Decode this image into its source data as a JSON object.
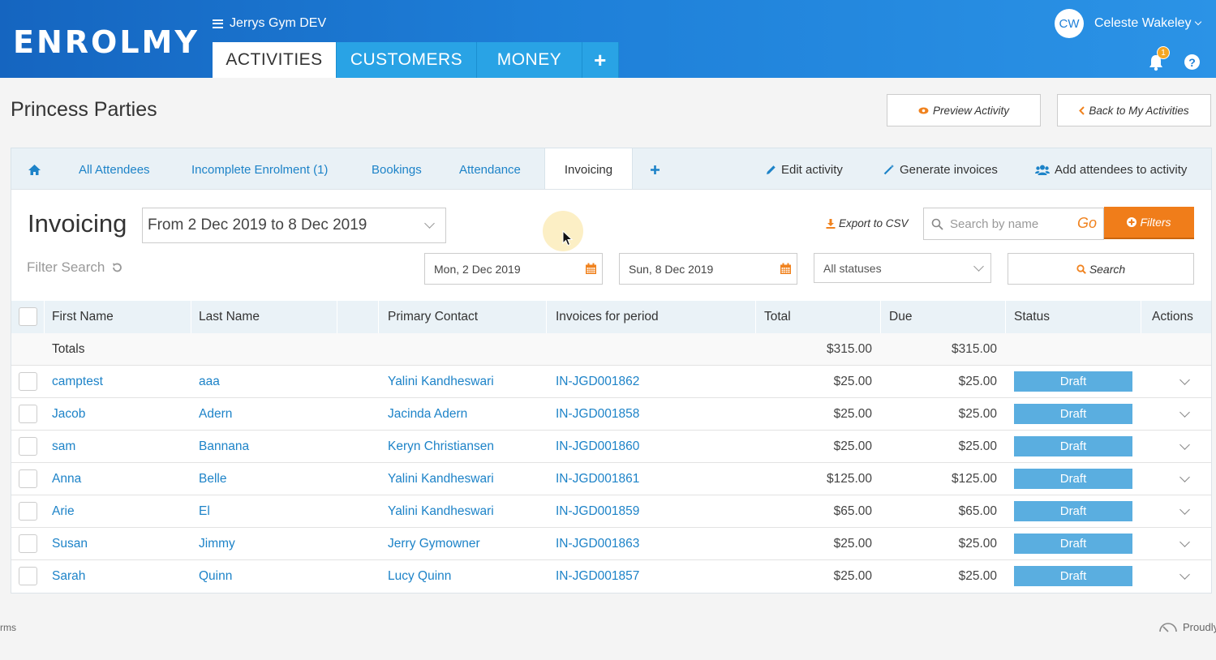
{
  "header": {
    "logo": "ENROLMY",
    "site": "Jerrys Gym DEV",
    "tabs": [
      "ACTIVITIES",
      "CUSTOMERS",
      "MONEY"
    ],
    "plus": "+",
    "avatar": "CW",
    "user": "Celeste Wakeley",
    "notifications": "1",
    "help": "?",
    "brand_color": "#1e7fd8"
  },
  "page": {
    "title": "Princess Parties",
    "preview": "Preview Activity",
    "back": "Back to My Activities"
  },
  "activity_tabs": {
    "items": [
      "All Attendees",
      "Incomplete Enrolment (1)",
      "Bookings",
      "Attendance",
      "Invoicing"
    ],
    "edit": "Edit activity",
    "generate": "Generate invoices",
    "add": "Add attendees to activity"
  },
  "invoicing": {
    "title": "Invoicing",
    "period": "From 2 Dec 2019 to 8 Dec 2019",
    "export": "Export to CSV",
    "search_placeholder": "Search by name",
    "go": "Go",
    "filters": "Filters",
    "filter_search": "Filter Search",
    "from_date": "Mon, 2 Dec 2019",
    "to_date": "Sun, 8 Dec 2019",
    "status": "All statuses",
    "search": "Search"
  },
  "table": {
    "columns": [
      "First Name",
      "Last Name",
      "Primary Contact",
      "Invoices for period",
      "Total",
      "Due",
      "Status",
      "Actions"
    ],
    "totals": {
      "label": "Totals",
      "total": "$315.00",
      "due": "$315.00"
    },
    "rows": [
      {
        "first": "camptest",
        "last": "aaa",
        "contact": "Yalini Kandheswari",
        "invoice": "IN-JGD001862",
        "total": "$25.00",
        "due": "$25.00",
        "status": "Draft"
      },
      {
        "first": "Jacob",
        "last": "Adern",
        "contact": "Jacinda Adern",
        "invoice": "IN-JGD001858",
        "total": "$25.00",
        "due": "$25.00",
        "status": "Draft"
      },
      {
        "first": "sam",
        "last": "Bannana",
        "contact": "Keryn Christiansen",
        "invoice": "IN-JGD001860",
        "total": "$25.00",
        "due": "$25.00",
        "status": "Draft"
      },
      {
        "first": "Anna",
        "last": "Belle",
        "contact": "Yalini Kandheswari",
        "invoice": "IN-JGD001861",
        "total": "$125.00",
        "due": "$125.00",
        "status": "Draft"
      },
      {
        "first": "Arie",
        "last": "El",
        "contact": "Yalini Kandheswari",
        "invoice": "IN-JGD001859",
        "total": "$65.00",
        "due": "$65.00",
        "status": "Draft"
      },
      {
        "first": "Susan",
        "last": "Jimmy",
        "contact": "Jerry Gymowner",
        "invoice": "IN-JGD001863",
        "total": "$25.00",
        "due": "$25.00",
        "status": "Draft"
      },
      {
        "first": "Sarah",
        "last": "Quinn",
        "contact": "Lucy Quinn",
        "invoice": "IN-JGD001857",
        "total": "$25.00",
        "due": "$25.00",
        "status": "Draft"
      }
    ]
  },
  "footer": {
    "left": "rms",
    "right": "Proudly"
  }
}
